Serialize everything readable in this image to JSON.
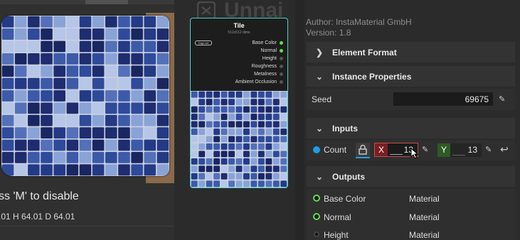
{
  "viewport": {
    "hint": "ss 'M' to disable",
    "dims": ".01 H 64.01 D 64.01"
  },
  "graph": {
    "title": "Unnai",
    "node": {
      "title": "Tile",
      "subtitle": "512x512 dims",
      "pill": "Tags set",
      "ports": [
        "Base Color",
        "Normal",
        "Height",
        "Roughness",
        "Metalness",
        "Ambient Occlusion"
      ],
      "ports_active": [
        true,
        true,
        false,
        false,
        false,
        false
      ]
    }
  },
  "properties": {
    "author": "Author: InstaMaterial GmbH",
    "version": "Version: 1.8",
    "sections": {
      "element_format": "Element Format",
      "instance_properties": "Instance Properties",
      "inputs": "Inputs",
      "outputs": "Outputs"
    },
    "seed": {
      "label": "Seed",
      "value": "69675"
    },
    "count": {
      "label": "Count",
      "x_label": "X",
      "x_value": "13",
      "y_label": "Y",
      "y_value": "13"
    },
    "outputs": [
      {
        "name": "Base Color",
        "type": "Material",
        "active": true
      },
      {
        "name": "Normal",
        "type": "Material",
        "active": true
      },
      {
        "name": "Height",
        "type": "Material",
        "active": false
      }
    ]
  },
  "colors": {
    "node_border": "#3fd4cf",
    "port_active": "#5ce04a",
    "x_axis": "#7a1f22",
    "y_axis": "#2f5a24",
    "tile_dark": "#1f2c6e",
    "tile_light": "#8aa3d6"
  }
}
